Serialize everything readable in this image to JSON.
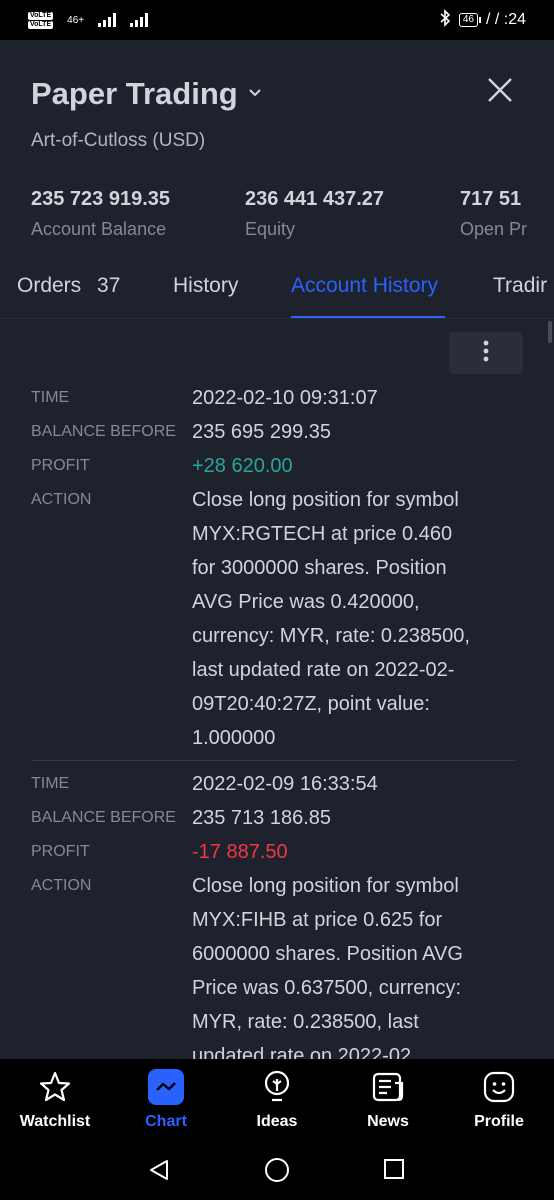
{
  "status_bar": {
    "volte1": "VoLTE",
    "volte2": "VoLTE",
    "network": "46+",
    "battery": "46",
    "time": "/ / :24"
  },
  "header": {
    "title": "Paper Trading",
    "subtitle": "Art-of-Cutloss (USD)",
    "metrics": [
      {
        "value": "235 723 919.35",
        "label": "Account Balance"
      },
      {
        "value": "236 441 437.27",
        "label": "Equity"
      },
      {
        "value": "717 51",
        "label": "Open Pr"
      }
    ]
  },
  "tabs": [
    {
      "label": "Orders",
      "count": "37"
    },
    {
      "label": "History"
    },
    {
      "label": "Account History",
      "active": true
    },
    {
      "label": "Tradir"
    }
  ],
  "labels": {
    "time": "TIME",
    "balance_before": "BALANCE BEFORE",
    "profit": "PROFIT",
    "action": "ACTION"
  },
  "entries": [
    {
      "time": "2022-02-10 09:31:07",
      "balance_before": "235 695 299.35",
      "profit": "+28 620.00",
      "action_lines": [
        "Close long position for symbol",
        "MYX:RGTECH at price 0.460",
        "for 3000000 shares. Position",
        "AVG Price was 0.420000,",
        "currency: MYR, rate: 0.238500,",
        "last updated rate on 2022-02-",
        "09T20:40:27Z, point value:",
        "1.000000"
      ]
    },
    {
      "time": "2022-02-09 16:33:54",
      "balance_before": "235 713 186.85",
      "profit": "-17 887.50",
      "action_lines": [
        "Close long position for symbol",
        "MYX:FIHB at price 0.625 for",
        "6000000 shares. Position AVG",
        "Price was 0.637500, currency:",
        "MYR, rate: 0.238500, last",
        "updated rate on 2022-02"
      ]
    }
  ],
  "bottom_nav": [
    {
      "label": "Watchlist",
      "icon": "star-icon"
    },
    {
      "label": "Chart",
      "icon": "chart-icon",
      "active": true
    },
    {
      "label": "Ideas",
      "icon": "lightbulb-icon"
    },
    {
      "label": "News",
      "icon": "news-icon"
    },
    {
      "label": "Profile",
      "icon": "smiley-icon"
    }
  ],
  "colors": {
    "accent": "#2962ff",
    "profit_positive": "#26a69a",
    "profit_negative": "#f23645",
    "background": "#1e222d"
  }
}
